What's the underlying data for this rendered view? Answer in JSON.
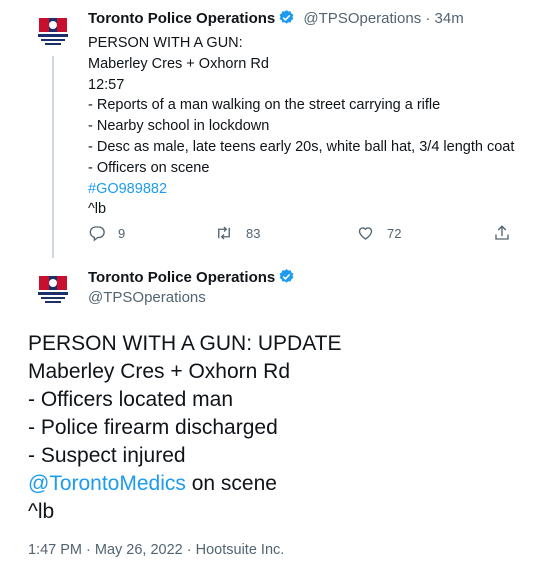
{
  "tweet1": {
    "display_name": "Toronto Police Operations",
    "handle": "@TPSOperations",
    "separator": "·",
    "time_ago": "34m",
    "lines": [
      "PERSON WITH A GUN:",
      "Maberley Cres + Oxhorn Rd",
      "12:57",
      "- Reports of a man walking on the street carrying a rifle",
      "- Nearby school in lockdown",
      "- Desc as male, late teens early 20s, white ball hat, 3/4 length coat",
      "- Officers on scene"
    ],
    "hashtag": "#GO989882",
    "signoff": "^lb",
    "stats": {
      "replies": "9",
      "retweets": "83",
      "likes": "72"
    }
  },
  "tweet2": {
    "display_name": "Toronto Police Operations",
    "handle": "@TPSOperations",
    "lines": [
      "PERSON WITH A GUN: UPDATE",
      "Maberley Cres + Oxhorn Rd",
      "- Officers located man",
      "- Police firearm discharged",
      "- Suspect injured"
    ],
    "mention": "@TorontoMedics",
    "mention_suffix": " on scene",
    "signoff": "^lb",
    "timestamp": "1:47 PM · May 26, 2022 · Hootsuite Inc."
  },
  "colors": {
    "link": "#1d9bf0",
    "muted": "#536471",
    "text": "#0f1419",
    "verified": "#1d9bf0"
  },
  "icons": [
    "reply-icon",
    "retweet-icon",
    "like-icon",
    "share-icon",
    "verified-badge-icon"
  ]
}
